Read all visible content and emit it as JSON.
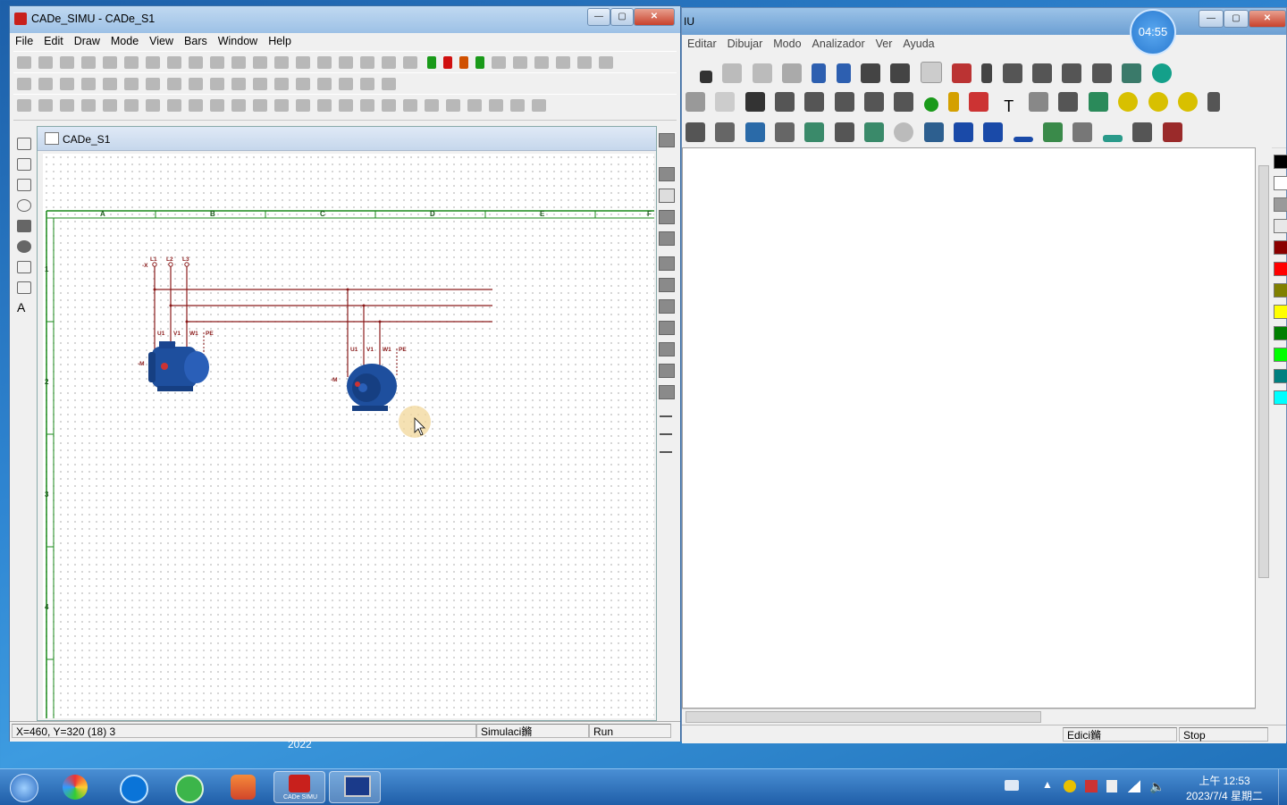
{
  "left_window": {
    "title": "CADe_SIMU - CADe_S1",
    "menu": [
      "File",
      "Edit",
      "Draw",
      "Mode",
      "View",
      "Bars",
      "Window",
      "Help"
    ],
    "child_title": "CADe_S1",
    "column_labels": [
      "A",
      "B",
      "C",
      "D",
      "E",
      "F"
    ],
    "row_labels": [
      "1",
      "2",
      "3",
      "4"
    ],
    "circuit": {
      "supply_label": "-X",
      "phases": [
        "L1",
        "L2",
        "L3"
      ],
      "motor_terminals": [
        "U1",
        "V1",
        "W1",
        "PE"
      ],
      "motor_label": "-M"
    },
    "status": {
      "coords": "X=460, Y=320 (18) 3",
      "mode": "Simulaci鏅",
      "state": "Run"
    }
  },
  "right_window": {
    "title_fragment": "IU",
    "menu": [
      "Editar",
      "Dibujar",
      "Modo",
      "Analizador",
      "Ver",
      "Ayuda"
    ],
    "status": {
      "mode": "Edici鏅",
      "state": "Stop"
    },
    "palette_colors": [
      "#000000",
      "#ffffff",
      "#9a9a9a",
      "#e8e8e8",
      "#8b0000",
      "#ff0000",
      "#808000",
      "#ffff00",
      "#007f00",
      "#00ff00",
      "#008080",
      "#00ffff"
    ]
  },
  "timer": "04:55",
  "desktop_fragment": "2022",
  "taskbar": {
    "time": "上午 12:53",
    "date": "2023/7/4 星期二",
    "cade_label": "CADe SIMU"
  }
}
